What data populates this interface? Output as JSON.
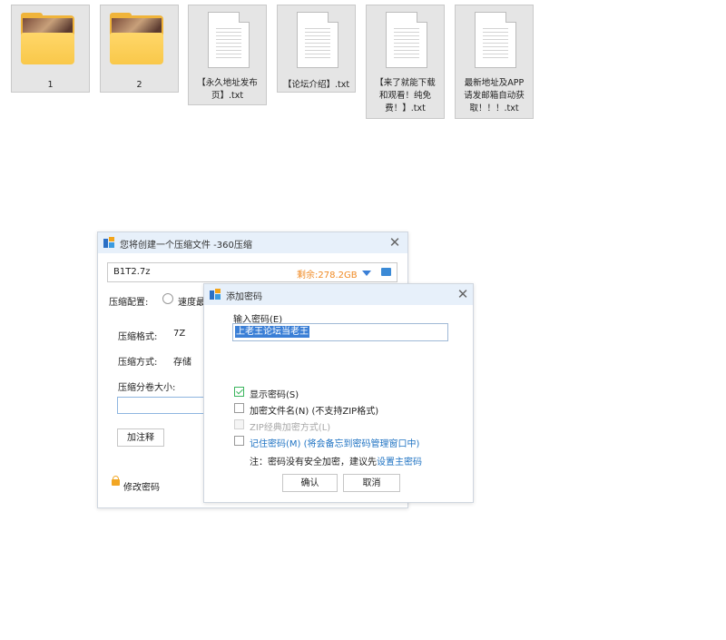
{
  "files": [
    {
      "type": "folder",
      "label": "1"
    },
    {
      "type": "folder",
      "label": "2"
    },
    {
      "type": "txt",
      "label_lines": [
        "【永久地址发布",
        "页】.txt"
      ]
    },
    {
      "type": "txt",
      "label_lines": [
        "【论坛介绍】.txt"
      ]
    },
    {
      "type": "txt",
      "label_lines": [
        "【来了就能下载",
        "和观看！纯免",
        "费！】.txt"
      ]
    },
    {
      "type": "txt",
      "label_lines": [
        "最新地址及APP",
        "请发邮箱自动获",
        "取！！！.txt"
      ]
    }
  ],
  "main_dialog": {
    "title": "您将创建一个压缩文件 -360压缩",
    "filename": "B1T2.7z",
    "free_space": "剩余:278.2GB",
    "config_label": "压缩配置:",
    "config_option": "速度最",
    "format_label": "压缩格式:",
    "format_value": "7Z",
    "method_label": "压缩方式:",
    "method_value": "存储",
    "split_label": "压缩分卷大小:",
    "comment_button": "加注释",
    "change_password": "修改密码",
    "colors": {
      "titlebar": "#e7f0fa",
      "free_space": "#f08a24",
      "link": "#1f73c3"
    }
  },
  "password_dialog": {
    "title": "添加密码",
    "input_label": "输入密码(E)",
    "password_value": "上老王论坛当老王",
    "show_password": "显示密码(S)",
    "show_password_checked": true,
    "encrypt_filename": "加密文件名(N) (不支持ZIP格式)",
    "encrypt_filename_checked": false,
    "zip_classic": "ZIP经典加密方式(L)",
    "zip_classic_disabled": true,
    "remember_link": "记住密码(M)",
    "remember_note": "(将会备忘到密码管理窗口中)",
    "note_prefix": "注：密码没有安全加密，建议先",
    "note_link": "设置主密码",
    "ok_button": "确认",
    "cancel_button": "取消",
    "colors": {
      "accent": "#3bb55d",
      "selection": "#3b7fd6"
    }
  }
}
